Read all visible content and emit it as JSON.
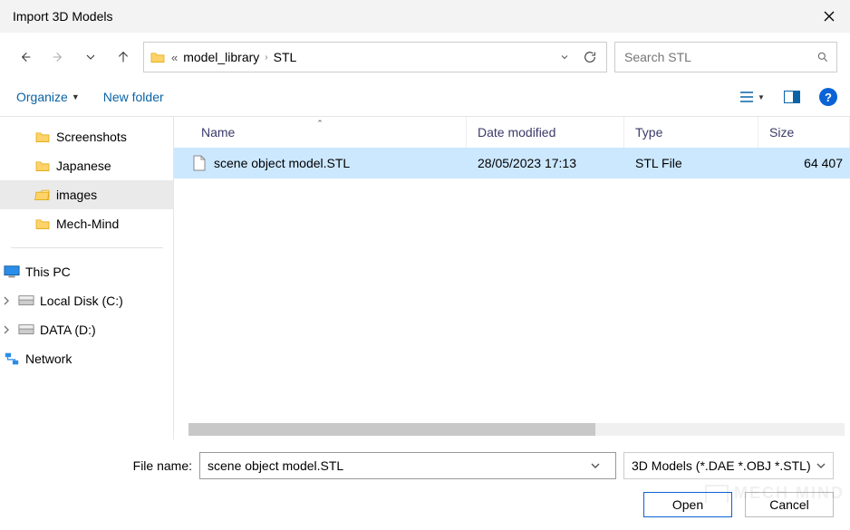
{
  "window": {
    "title": "Import 3D Models"
  },
  "breadcrumb": {
    "path1": "model_library",
    "path2": "STL"
  },
  "search": {
    "placeholder": "Search STL"
  },
  "toolbar": {
    "organize": "Organize",
    "new_folder": "New folder"
  },
  "sidebar": {
    "screenshots": "Screenshots",
    "japanese": "Japanese",
    "images": "images",
    "mechmind": "Mech-Mind",
    "thispc": "This PC",
    "localdisk": "Local Disk (C:)",
    "datad": "DATA (D:)",
    "network": "Network"
  },
  "columns": {
    "name": "Name",
    "date": "Date modified",
    "type": "Type",
    "size": "Size"
  },
  "file": {
    "name": "scene object model.STL",
    "date": "28/05/2023 17:13",
    "type": "STL File",
    "size": "64 407"
  },
  "bottom": {
    "label": "File name:",
    "value": "scene object model.STL",
    "filter": "3D Models (*.DAE *.OBJ *.STL)",
    "open": "Open",
    "cancel": "Cancel"
  },
  "icons": {
    "help": "?"
  },
  "watermark": "MECH MIND"
}
